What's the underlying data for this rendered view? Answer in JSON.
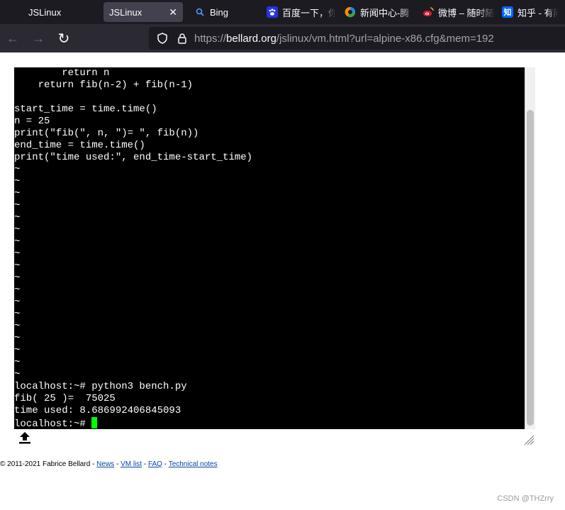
{
  "tabs": [
    {
      "label": "JSLinux",
      "icon": "jslinux-icon",
      "active": false
    },
    {
      "label": "JSLinux",
      "icon": "jslinux-icon",
      "active": true,
      "close": "✕"
    },
    {
      "label": "Bing",
      "icon": "search-icon",
      "active": false
    },
    {
      "label": "百度一下，你",
      "icon": "baidu-paw-icon",
      "active": false,
      "icon_color": "#2932e1"
    },
    {
      "label": "新闻中心-腾",
      "icon": "tencent-news-icon",
      "active": false
    },
    {
      "label": "微博 – 随时随",
      "icon": "weibo-icon",
      "active": false,
      "icon_color": "#e6162d"
    },
    {
      "label": "知乎 - 有问题",
      "icon": "zhihu-icon",
      "icon_text": "知",
      "active": false,
      "icon_color": "#0066ff"
    }
  ],
  "nav": {
    "back": "←",
    "forward": "→",
    "reload": "↻",
    "url_prefix": "https://",
    "url_host": "bellard.org",
    "url_path": "/jslinux/vm.html?url=alpine-x86.cfg&mem=192"
  },
  "terminal": {
    "lines": [
      "        return n",
      "    return fib(n-2) + fib(n-1)",
      "",
      "start_time = time.time()",
      "n = 25",
      "print(\"fib(\", n, \")= \", fib(n))",
      "end_time = time.time()",
      "print(\"time used:\", end_time-start_time)",
      "~",
      "~",
      "~",
      "~",
      "~",
      "~",
      "~",
      "~",
      "~",
      "~",
      "~",
      "~",
      "~",
      "~",
      "~",
      "~",
      "~",
      "~",
      "localhost:~# python3 bench.py",
      "fib( 25 )=  75025",
      "time used: 8.686992406845093"
    ],
    "prompt": "localhost:~# "
  },
  "footer": {
    "copyright": "© 2011-2021 Fabrice Bellard - ",
    "links": [
      "News",
      "VM list",
      "FAQ",
      "Technical notes"
    ],
    "sep": " - "
  },
  "watermark": "CSDN @THZrry",
  "colors": {
    "tabbar_bg": "#1c1b22",
    "navbar_bg": "#2b2a33",
    "terminal_bg": "#000000",
    "cursor": "#00ff00",
    "link": "#0645ad"
  }
}
